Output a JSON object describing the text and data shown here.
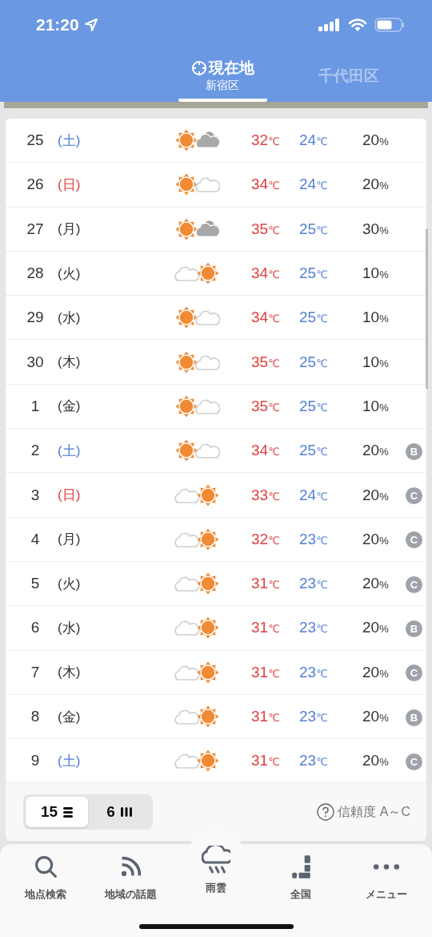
{
  "status_bar": {
    "time": "21:20"
  },
  "header_tabs": [
    {
      "label": "現在地",
      "sublabel": "新宿区",
      "kind": "current_location",
      "selected": true
    },
    {
      "label": "千代田区",
      "kind": "place",
      "selected": false
    }
  ],
  "forecast": [
    {
      "day": "25",
      "weekday": "(土)",
      "color": "#4c78d6",
      "kind": "sun_gray_cloud",
      "high": "32",
      "high_unit": "℃",
      "low": "24",
      "low_unit": "℃",
      "rain": "20",
      "rain_unit": "%"
    },
    {
      "day": "26",
      "weekday": "(日)",
      "color": "#e03a3a",
      "kind": "sun_white_cloud",
      "high": "34",
      "high_unit": "℃",
      "low": "24",
      "low_unit": "℃",
      "rain": "20",
      "rain_unit": "%"
    },
    {
      "day": "27",
      "weekday": "(月)",
      "color": "#333333",
      "kind": "sun_gray_cloud",
      "high": "35",
      "high_unit": "℃",
      "low": "25",
      "low_unit": "℃",
      "rain": "30",
      "rain_unit": "%"
    },
    {
      "day": "28",
      "weekday": "(火)",
      "color": "#333333",
      "kind": "cloud_sun",
      "high": "34",
      "high_unit": "℃",
      "low": "25",
      "low_unit": "℃",
      "rain": "10",
      "rain_unit": "%"
    },
    {
      "day": "29",
      "weekday": "(水)",
      "color": "#333333",
      "kind": "sun_white_cloud",
      "high": "34",
      "high_unit": "℃",
      "low": "25",
      "low_unit": "℃",
      "rain": "10",
      "rain_unit": "%"
    },
    {
      "day": "30",
      "weekday": "(木)",
      "color": "#333333",
      "kind": "sun_white_cloud",
      "high": "35",
      "high_unit": "℃",
      "low": "25",
      "low_unit": "℃",
      "rain": "10",
      "rain_unit": "%"
    },
    {
      "day": "1",
      "weekday": "(金)",
      "color": "#333333",
      "kind": "sun_white_cloud",
      "high": "35",
      "high_unit": "℃",
      "low": "25",
      "low_unit": "℃",
      "rain": "10",
      "rain_unit": "%"
    },
    {
      "day": "2",
      "weekday": "(土)",
      "color": "#4c78d6",
      "kind": "sun_white_cloud",
      "high": "34",
      "high_unit": "℃",
      "low": "25",
      "low_unit": "℃",
      "rain": "20",
      "rain_unit": "%",
      "reliability": "B"
    },
    {
      "day": "3",
      "weekday": "(日)",
      "color": "#e03a3a",
      "kind": "cloud_sun",
      "high": "33",
      "high_unit": "℃",
      "low": "24",
      "low_unit": "℃",
      "rain": "20",
      "rain_unit": "%",
      "reliability": "C"
    },
    {
      "day": "4",
      "weekday": "(月)",
      "color": "#333333",
      "kind": "cloud_sun",
      "high": "32",
      "high_unit": "℃",
      "low": "23",
      "low_unit": "℃",
      "rain": "20",
      "rain_unit": "%",
      "reliability": "C"
    },
    {
      "day": "5",
      "weekday": "(火)",
      "color": "#333333",
      "kind": "cloud_sun",
      "high": "31",
      "high_unit": "℃",
      "low": "23",
      "low_unit": "℃",
      "rain": "20",
      "rain_unit": "%",
      "reliability": "C"
    },
    {
      "day": "6",
      "weekday": "(水)",
      "color": "#333333",
      "kind": "cloud_sun",
      "high": "31",
      "high_unit": "℃",
      "low": "23",
      "low_unit": "℃",
      "rain": "20",
      "rain_unit": "%",
      "reliability": "B"
    },
    {
      "day": "7",
      "weekday": "(木)",
      "color": "#333333",
      "kind": "cloud_sun",
      "high": "31",
      "high_unit": "℃",
      "low": "23",
      "low_unit": "℃",
      "rain": "20",
      "rain_unit": "%",
      "reliability": "C"
    },
    {
      "day": "8",
      "weekday": "(金)",
      "color": "#333333",
      "kind": "cloud_sun",
      "high": "31",
      "high_unit": "℃",
      "low": "23",
      "low_unit": "℃",
      "rain": "20",
      "rain_unit": "%",
      "reliability": "B"
    },
    {
      "day": "9",
      "weekday": "(土)",
      "color": "#4c78d6",
      "kind": "cloud_sun",
      "high": "31",
      "high_unit": "℃",
      "low": "23",
      "low_unit": "℃",
      "rain": "20",
      "rain_unit": "%",
      "reliability": "C"
    }
  ],
  "view_toggle": [
    {
      "label": "15",
      "kind": "list",
      "selected": true
    },
    {
      "label": "6",
      "kind": "columns",
      "selected": false
    }
  ],
  "reliability_note": "信頼度 A～C",
  "bottom_nav": [
    {
      "label": "地点検索",
      "kind": "search"
    },
    {
      "label": "地域の話題",
      "kind": "topics"
    },
    {
      "label": "雨雲",
      "kind": "rain"
    },
    {
      "label": "全国",
      "kind": "national"
    },
    {
      "label": "メニュー",
      "kind": "menu"
    }
  ]
}
